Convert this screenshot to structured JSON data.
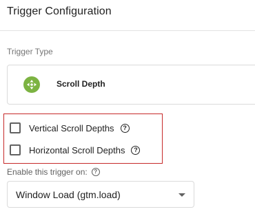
{
  "header": {
    "title": "Trigger Configuration"
  },
  "trigger_type": {
    "label": "Trigger Type",
    "name": "Scroll Depth",
    "icon": "scroll-depth-arrows-icon",
    "icon_color": "#7cb342"
  },
  "options": {
    "highlight_color": "#c62828",
    "items": [
      {
        "label": "Vertical Scroll Depths",
        "checked": false
      },
      {
        "label": "Horizontal Scroll Depths",
        "checked": false
      }
    ],
    "help_glyph": "?"
  },
  "enable_on": {
    "label": "Enable this trigger on:",
    "help_glyph": "?",
    "selected": "Window Load (gtm.load)"
  }
}
